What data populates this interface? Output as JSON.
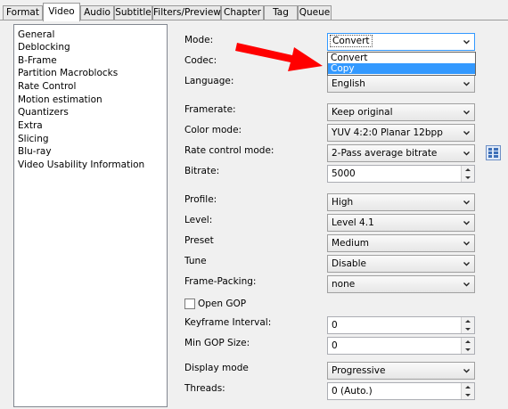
{
  "tabs": [
    "Format",
    "Video",
    "Audio",
    "Subtitle",
    "Filters/Preview",
    "Chapter",
    "Tag",
    "Queue"
  ],
  "active_tab": "Video",
  "sidebar": {
    "items": [
      "General",
      "Deblocking",
      "B-Frame",
      "Partition Macroblocks",
      "Rate Control",
      "Motion estimation",
      "Quantizers",
      "Extra",
      "Slicing",
      "Blu-ray",
      "Video Usability Information"
    ]
  },
  "form": {
    "mode_label": "Mode:",
    "mode_value": "Convert",
    "mode_options": [
      "Convert",
      "Copy"
    ],
    "mode_highlighted": "Copy",
    "codec_label": "Codec:",
    "language_label": "Language:",
    "language_value": "English",
    "framerate_label": "Framerate:",
    "framerate_value": "Keep original",
    "color_mode_label": "Color mode:",
    "color_mode_value": "YUV 4:2:0 Planar 12bpp",
    "rate_control_label": "Rate control mode:",
    "rate_control_value": "2-Pass average bitrate",
    "bitrate_label": "Bitrate:",
    "bitrate_value": "5000",
    "profile_label": "Profile:",
    "profile_value": "High",
    "level_label": "Level:",
    "level_value": "Level 4.1",
    "preset_label": "Preset",
    "preset_value": "Medium",
    "tune_label": "Tune",
    "tune_value": "Disable",
    "frame_packing_label": "Frame-Packing:",
    "frame_packing_value": "none",
    "open_gop_label": "Open GOP",
    "open_gop_checked": false,
    "keyframe_label": "Keyframe Interval:",
    "keyframe_value": "0",
    "min_gop_label": "Min GOP Size:",
    "min_gop_value": "0",
    "display_mode_label": "Display mode",
    "display_mode_value": "Progressive",
    "threads_label": "Threads:",
    "threads_value": "0 (Auto.)"
  },
  "annotation": {
    "arrow_color": "#ff0000"
  },
  "colors": {
    "selection": "#3399ff",
    "focus_border": "#3399ff"
  }
}
